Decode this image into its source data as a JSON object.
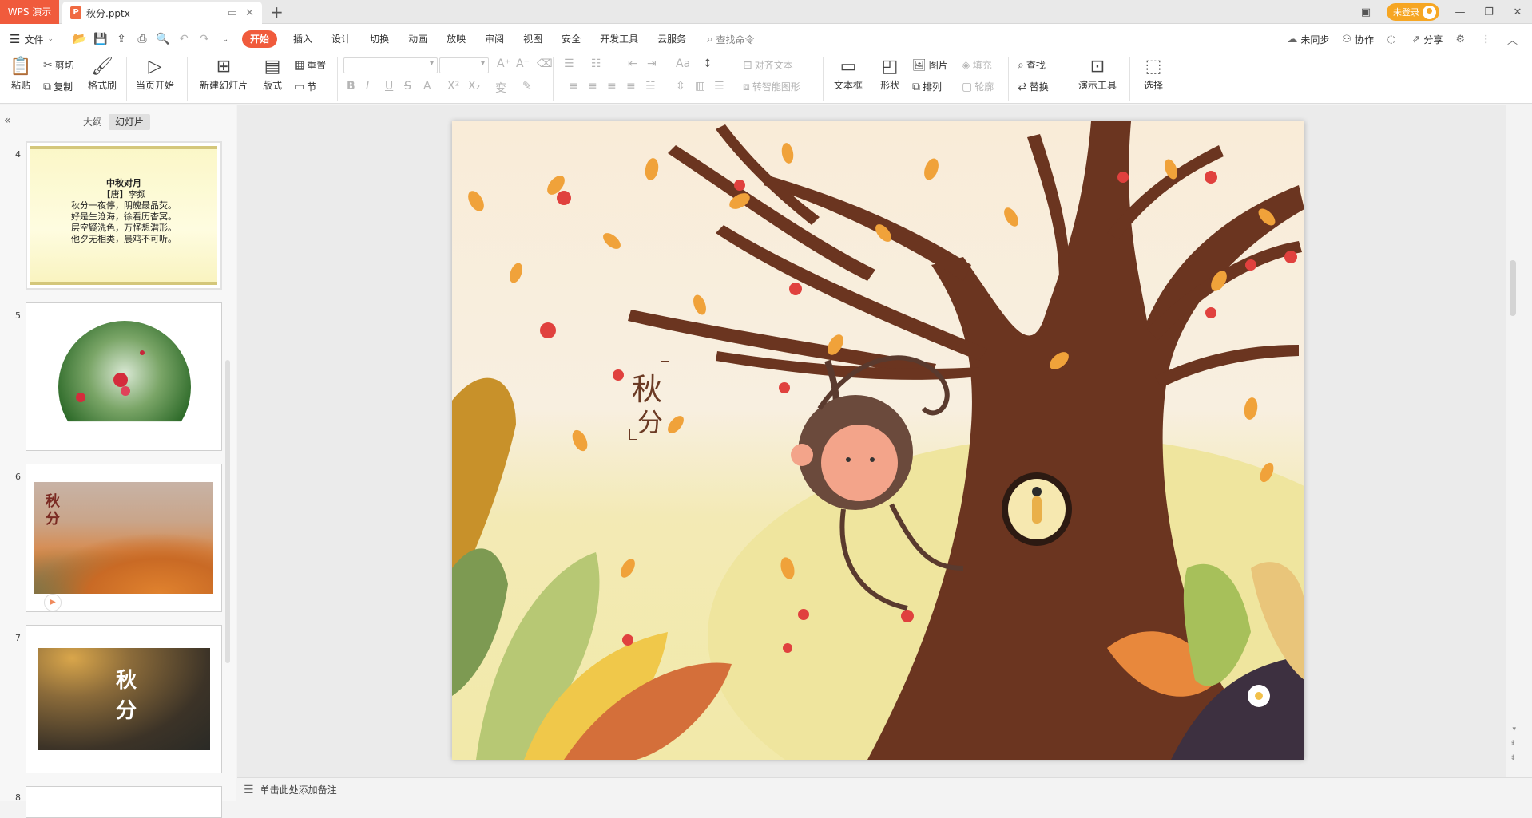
{
  "titlebar": {
    "app_tab": "WPS 演示",
    "doc_title": "秋分.pptx",
    "login_label": "未登录"
  },
  "menubar": {
    "file_label": "文件",
    "tabs": [
      "开始",
      "插入",
      "设计",
      "切换",
      "动画",
      "放映",
      "审阅",
      "视图",
      "安全",
      "开发工具",
      "云服务"
    ],
    "search_placeholder": "查找命令",
    "right": {
      "sync": "未同步",
      "collab": "协作",
      "share": "分享"
    }
  },
  "ribbon": {
    "paste": "粘贴",
    "cut": "剪切",
    "copy": "复制",
    "format_painter": "格式刷",
    "start_from_current": "当页开始",
    "new_slide": "新建幻灯片",
    "layout": "版式",
    "reset": "重置",
    "section": "节",
    "align_text": "对齐文本",
    "smartart": "转智能图形",
    "textbox": "文本框",
    "shape": "形状",
    "picture": "图片",
    "fill": "填充",
    "arrange": "排列",
    "outline": "轮廓",
    "find": "查找",
    "replace": "替换",
    "presentation_tools": "演示工具",
    "select": "选择"
  },
  "leftpanel": {
    "outline_tab": "大纲",
    "slides_tab": "幻灯片",
    "slides": [
      {
        "num": "4"
      },
      {
        "num": "5"
      },
      {
        "num": "6"
      },
      {
        "num": "7"
      },
      {
        "num": "8"
      }
    ],
    "slide4": {
      "title": "中秋对月",
      "author": "【唐】李频",
      "lines": [
        "秋分一夜停，阴魄最晶荧。",
        "好是生沧海，徐看历杳冥。",
        "层空疑洗色，万怪想潜形。",
        "他夕无相类，晨鸡不可听。"
      ]
    },
    "slide6_title": "秋分",
    "slide7_title": "秋分"
  },
  "slide": {
    "title_char1": "秋",
    "title_char2": "分"
  },
  "notes": {
    "placeholder": "单击此处添加备注"
  },
  "colors": {
    "accent": "#f05b3c",
    "login": "#f6a623"
  }
}
